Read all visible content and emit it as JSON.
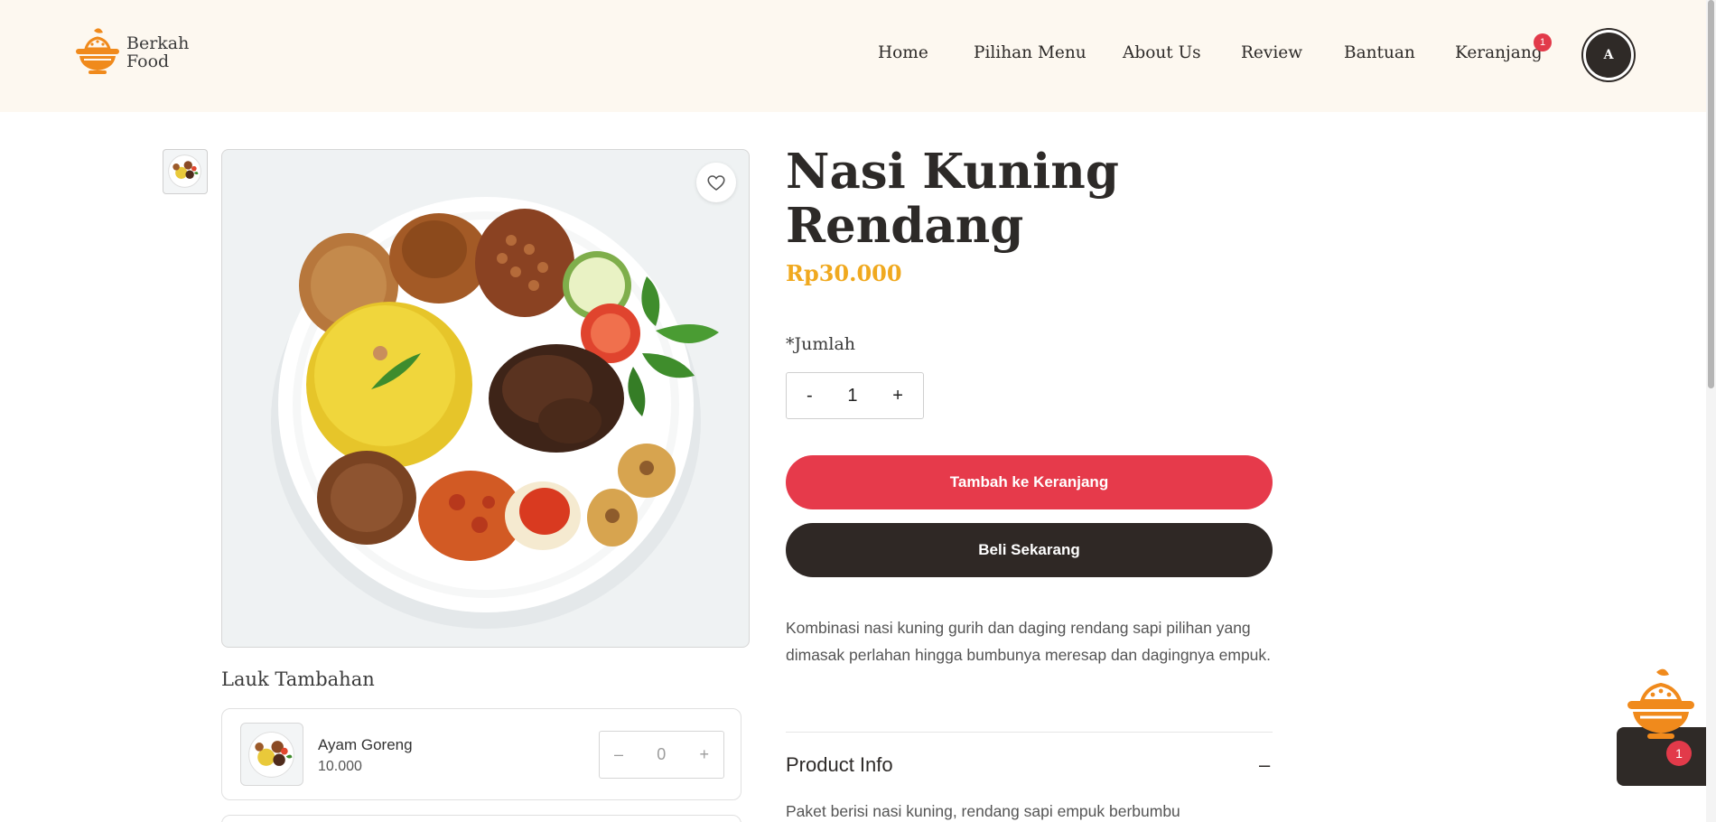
{
  "brand": {
    "name_line1": "Berkah",
    "name_line2": "Food",
    "accent_color": "#f08a1c"
  },
  "nav": {
    "items": [
      {
        "label": "Home"
      },
      {
        "label": "Pilihan Menu"
      },
      {
        "label": "About Us"
      },
      {
        "label": "Review"
      },
      {
        "label": "Bantuan"
      },
      {
        "label": "Keranjang"
      }
    ],
    "cart_badge": "1",
    "avatar_initial": "A"
  },
  "product": {
    "title_line1": "Nasi Kuning",
    "title_line2": "Rendang",
    "price": "Rp30.000",
    "qty_label": "*Jumlah",
    "qty_minus": "-",
    "qty_value": "1",
    "qty_plus": "+",
    "add_to_cart_label": "Tambah ke Keranjang",
    "buy_now_label": "Beli Sekarang",
    "description": "Kombinasi nasi kuning gurih dan daging rendang sapi pilihan yang dimasak perlahan hingga bumbunya meresap dan dagingnya empuk.",
    "info_title": "Product Info",
    "info_toggle": "–",
    "info_text": "Paket berisi nasi kuning, rendang sapi empuk berbumbu"
  },
  "addons": {
    "section_title": "Lauk Tambahan",
    "items": [
      {
        "name": "Ayam Goreng",
        "price": "10.000",
        "minus": "–",
        "qty": "0",
        "plus": "+"
      }
    ]
  },
  "float_cart": {
    "badge": "1"
  },
  "colors": {
    "primary_red": "#e63a4b",
    "dark": "#2f2825",
    "price_gold": "#f0a91f",
    "header_bg": "#fdf8f0"
  }
}
